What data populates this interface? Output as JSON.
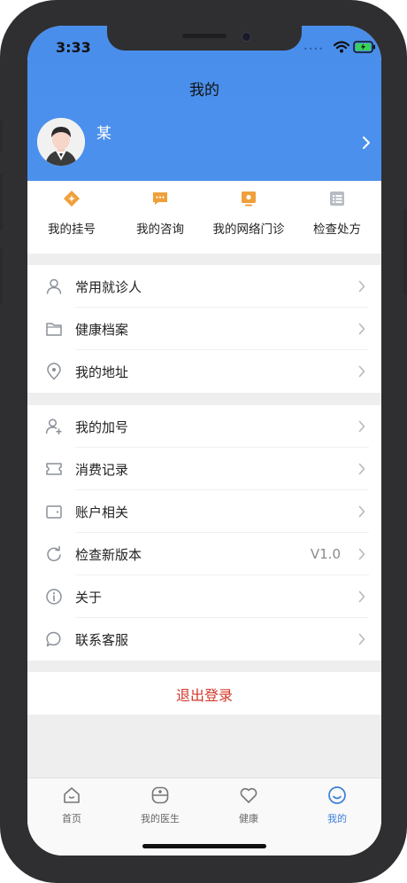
{
  "status_bar": {
    "time": "3:33"
  },
  "header": {
    "title": "我的",
    "username": "某"
  },
  "quick_actions": [
    {
      "label": "我的挂号",
      "icon": "registration-icon"
    },
    {
      "label": "我的咨询",
      "icon": "consultation-icon"
    },
    {
      "label": "我的网络门诊",
      "icon": "online-clinic-icon"
    },
    {
      "label": "检查处方",
      "icon": "prescription-icon"
    }
  ],
  "group1": [
    {
      "label": "常用就诊人",
      "icon": "person-icon"
    },
    {
      "label": "健康档案",
      "icon": "folder-icon"
    },
    {
      "label": "我的地址",
      "icon": "location-icon"
    }
  ],
  "group2": [
    {
      "label": "我的加号",
      "icon": "add-person-icon"
    },
    {
      "label": "消费记录",
      "icon": "ticket-icon"
    },
    {
      "label": "账户相关",
      "icon": "wallet-icon"
    },
    {
      "label": "检查新版本",
      "icon": "refresh-icon",
      "value": "V1.0"
    },
    {
      "label": "关于",
      "icon": "info-icon"
    },
    {
      "label": "联系客服",
      "icon": "chat-icon"
    }
  ],
  "logout_label": "退出登录",
  "tabs": [
    {
      "label": "首页",
      "icon": "home-icon",
      "active": false
    },
    {
      "label": "我的医生",
      "icon": "doctor-icon",
      "active": false
    },
    {
      "label": "健康",
      "icon": "heart-icon",
      "active": false
    },
    {
      "label": "我的",
      "icon": "smile-icon",
      "active": true
    }
  ],
  "colors": {
    "header_blue": "#4a8eeb",
    "accent_orange": "#f0a03a",
    "logout_red": "#d1372a",
    "tab_active": "#3a7fd8"
  }
}
